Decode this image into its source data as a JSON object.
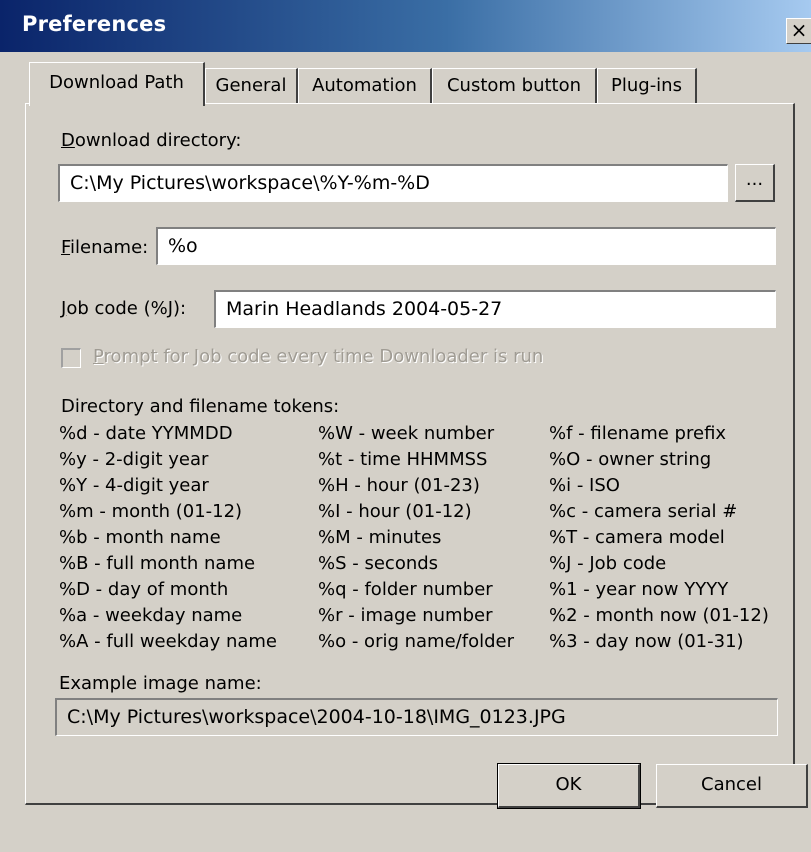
{
  "window": {
    "title": "Preferences",
    "close_glyph": "×"
  },
  "tabs": [
    {
      "label": "Download Path",
      "active": true
    },
    {
      "label": "General",
      "active": false
    },
    {
      "label": "Automation",
      "active": false
    },
    {
      "label": "Custom button",
      "active": false
    },
    {
      "label": "Plug-ins",
      "active": false
    }
  ],
  "download_directory": {
    "label_accel": "D",
    "label_rest": "ownload directory:",
    "value": "C:\\My Pictures\\workspace\\%Y-%m-%D",
    "browse_label": "..."
  },
  "filename": {
    "label_accel": "F",
    "label_rest": "ilename:",
    "value": "%o"
  },
  "job_code": {
    "label_accel": "J",
    "label_rest": "ob code (%J):",
    "value": "Marin Headlands 2004-05-27"
  },
  "prompt_checkbox": {
    "label_accel": "P",
    "label_rest": "rompt for Job code every time Downloader is run",
    "checked": false,
    "enabled": false
  },
  "tokens": {
    "heading": "Directory and filename tokens:",
    "columns": [
      [
        "%d - date YYMMDD",
        "%y - 2-digit year",
        "%Y - 4-digit year",
        "%m - month (01-12)",
        "%b - month name",
        "%B - full month name",
        "%D - day of month",
        "%a - weekday name",
        "%A - full weekday name"
      ],
      [
        "%W - week number",
        "%t - time HHMMSS",
        "%H - hour (01-23)",
        "%I - hour (01-12)",
        "%M - minutes",
        "%S - seconds",
        "%q - folder number",
        "%r - image number",
        "%o - orig name/folder"
      ],
      [
        "%f - filename prefix",
        "%O - owner string",
        "%i - ISO",
        "%c - camera serial #",
        "%T - camera model",
        "%J - Job code",
        "%1 - year now YYYY",
        "%2 - month now (01-12)",
        "%3 - day now (01-31)"
      ]
    ]
  },
  "example": {
    "label": "Example image name:",
    "value": "C:\\My Pictures\\workspace\\2004-10-18\\IMG_0123.JPG"
  },
  "buttons": {
    "ok": "OK",
    "cancel": "Cancel"
  }
}
